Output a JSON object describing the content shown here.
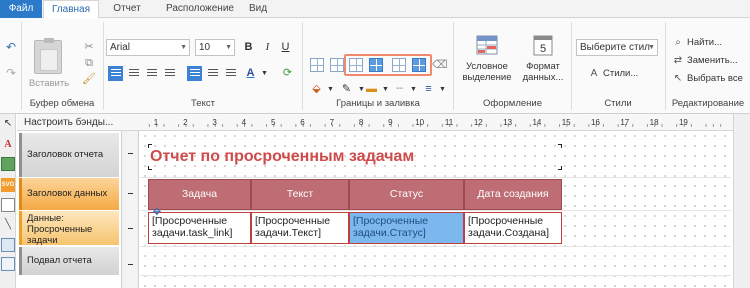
{
  "tabs": {
    "file": "Файл",
    "home": "Главная",
    "report": "Отчет",
    "layout": "Расположение",
    "view": "Вид"
  },
  "ribbon": {
    "clipboard": {
      "paste_label": "Вставить",
      "group_label": "Буфер обмена"
    },
    "text": {
      "font_family": "Arial",
      "font_size": "10",
      "group_label": "Текст"
    },
    "borders": {
      "group_label": "Границы и заливка"
    },
    "design": {
      "conditional_line1": "Условное",
      "conditional_line2": "выделение",
      "data_format_line1": "Формат",
      "data_format_line2": "данных...",
      "group_label": "Оформление"
    },
    "styles": {
      "select_placeholder": "Выберите стил",
      "styles_label": "Стили...",
      "group_label": "Стили"
    },
    "editing": {
      "find_label": "Найти...",
      "replace_label": "Заменить...",
      "select_all_label": "Выбрать все",
      "group_label": "Редактирование"
    }
  },
  "band_settings_label": "Настроить бэнды...",
  "ruler": {
    "ticks": [
      "1",
      "2",
      "3",
      "4",
      "5",
      "6",
      "7",
      "8",
      "9",
      "10",
      "11",
      "12",
      "13",
      "14",
      "15",
      "16",
      "17",
      "18",
      "19"
    ]
  },
  "bands": {
    "report_header": "Заголовок отчета",
    "data_header": "Заголовок данных",
    "data_line1": "Данные:",
    "data_line2": "Просроченные",
    "data_line3": "задачи",
    "report_footer": "Подвал отчета"
  },
  "report": {
    "title": "Отчет по просроченным задачам",
    "columns": [
      "Задача",
      "Текст",
      "Статус",
      "Дата создания"
    ],
    "cells": [
      [
        "[Просроченные",
        "задачи.task_link]"
      ],
      [
        "[Просроченные",
        "задачи.Текст]"
      ],
      [
        "[Просроченные",
        "задачи.Статус]"
      ],
      [
        "[Просроченные",
        "задачи.Создана]"
      ]
    ]
  },
  "colors": {
    "accent": "#2b79c9",
    "title_red": "#cf4b4b",
    "header_cell": "#bd6d73",
    "selected_cell": "#7cb7ee",
    "highlight_box": "#f0896e"
  },
  "icons": [
    "undo-icon",
    "redo-icon",
    "paste-icon",
    "cut-icon",
    "copy-icon",
    "format-painter-icon",
    "bold-icon",
    "italic-icon",
    "underline-icon",
    "align-icon",
    "fill-color-icon",
    "font-color-icon",
    "border-icon",
    "conditional-format-icon",
    "data-format-icon",
    "find-icon",
    "replace-icon",
    "select-all-icon",
    "pointer-icon",
    "text-tool-icon",
    "svg-icon"
  ]
}
